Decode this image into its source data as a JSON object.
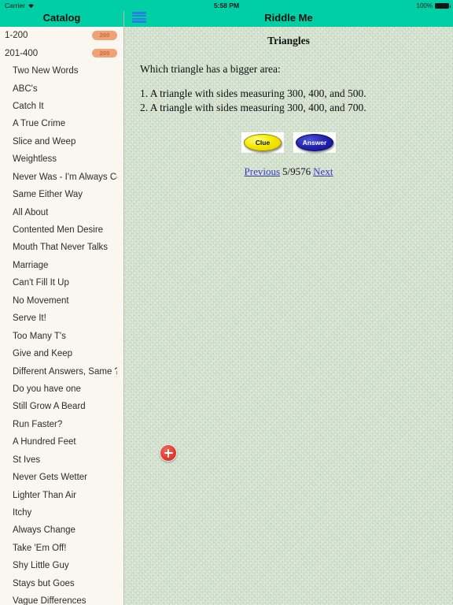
{
  "status_bar": {
    "carrier": "Carrier",
    "wifi_icon": "wifi-icon",
    "time": "5:58 PM",
    "battery_percent": "100%",
    "battery_icon": "battery-full-icon"
  },
  "sidebar": {
    "title": "Catalog",
    "groups": [
      {
        "label": "1-200",
        "badge": "200"
      },
      {
        "label": "201-400",
        "badge": "200"
      }
    ],
    "items": [
      {
        "label": "Two New Words"
      },
      {
        "label": "ABC's"
      },
      {
        "label": "Catch It"
      },
      {
        "label": "A True Crime"
      },
      {
        "label": "Slice and Weep"
      },
      {
        "label": "Weightless"
      },
      {
        "label": "Never Was -  I'm Always Co"
      },
      {
        "label": "Same Either Way"
      },
      {
        "label": "All About"
      },
      {
        "label": "Contented Men Desire"
      },
      {
        "label": "Mouth That Never Talks"
      },
      {
        "label": "Marriage"
      },
      {
        "label": "Can't Fill It Up"
      },
      {
        "label": "No Movement"
      },
      {
        "label": "Serve It!"
      },
      {
        "label": "Too Many T's"
      },
      {
        "label": "Give and Keep"
      },
      {
        "label": "Different Answers, Same ?'s"
      },
      {
        "label": "Do you have one"
      },
      {
        "label": "Still Grow A Beard"
      },
      {
        "label": "Run Faster?"
      },
      {
        "label": "A Hundred Feet"
      },
      {
        "label": "St Ives"
      },
      {
        "label": "Never Gets Wetter"
      },
      {
        "label": "Lighter Than Air"
      },
      {
        "label": "Itchy"
      },
      {
        "label": "Always Change"
      },
      {
        "label": "Take 'Em Off!"
      },
      {
        "label": "Shy Little Guy"
      },
      {
        "label": "Stays but Goes"
      },
      {
        "label": "Vague Differences"
      }
    ]
  },
  "navbar": {
    "menu_icon": "hamburger-menu-icon",
    "title": "Riddle Me"
  },
  "riddle": {
    "title": "Triangles",
    "question": "Which triangle has a bigger area:",
    "options": [
      "1. A triangle with sides measuring 300, 400, and 500.",
      "2. A triangle with sides measuring 300, 400, and 700."
    ],
    "clue_button": "Clue",
    "answer_button": "Answer",
    "previous_link": "Previous",
    "page_counter": "5/9576",
    "next_link": "Next"
  },
  "fab": {
    "icon": "plus-icon",
    "label": "+"
  },
  "colors": {
    "navbar_teal": "#00cfa6",
    "sidebar_bg": "#faf7f1",
    "content_bg": "#c9dcc2",
    "badge_bg": "#f0a176",
    "badge_text": "#c26b3d",
    "link_blue": "#3a3ac0",
    "hamburger_blue": "#2a7de1",
    "fab_red": "#e03a2f",
    "clue_yellow": "#f5e800",
    "answer_blue": "#2222b0"
  }
}
